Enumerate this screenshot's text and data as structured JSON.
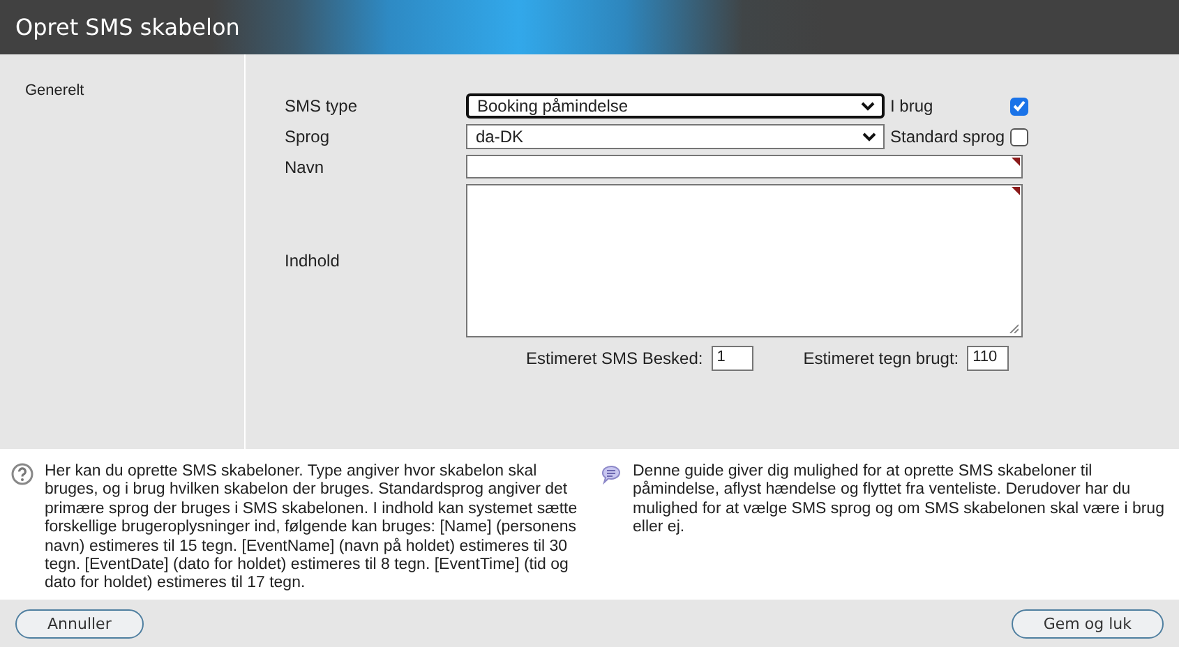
{
  "window": {
    "title": "Opret SMS skabelon"
  },
  "sidebar": {
    "items": [
      {
        "label": "Generelt",
        "selected": true
      }
    ]
  },
  "form": {
    "sms_type": {
      "label": "SMS type",
      "value": "Booking påmindelse",
      "focused": true
    },
    "in_use": {
      "label": "I brug",
      "checked": true
    },
    "language": {
      "label": "Sprog",
      "value": "da-DK"
    },
    "default_language": {
      "label": "Standard sprog",
      "checked": false
    },
    "name": {
      "label": "Navn",
      "required": true
    },
    "content": {
      "label": "Indhold",
      "required": true
    },
    "estimated_sms": {
      "label": "Estimeret SMS Besked:",
      "value": "1"
    },
    "estimated_chars": {
      "label": "Estimeret tegn brugt:",
      "value": "110"
    }
  },
  "help": [
    {
      "kind": "question",
      "text": "Her kan du oprette SMS skabeloner. Type angiver hvor skabelon skal bruges, og i brug hvilken skabelon der bruges. Standardsprog angiver det primære sprog der bruges i SMS skabelonen. I indhold kan systemet sætte forskellige brugeroplysninger ind, følgende kan bruges: [Name] (personens navn) estimeres til 15 tegn. [EventName] (navn på holdet) estimeres til 30 tegn. [EventDate] (dato for holdet) estimeres til 8 tegn. [EventTime] (tid og dato for holdet) estimeres til 17 tegn."
    },
    {
      "kind": "speech",
      "text": "Denne guide giver dig mulighed for at oprette SMS skabeloner til påmindelse, aflyst hændelse og flyttet fra venteliste. Derudover har du mulighed for at vælge SMS sprog og om SMS skabelonen skal være i brug eller ej."
    }
  ],
  "buttons": [
    {
      "label": "Annuller"
    },
    {
      "label": "Gem og luk"
    }
  ]
}
